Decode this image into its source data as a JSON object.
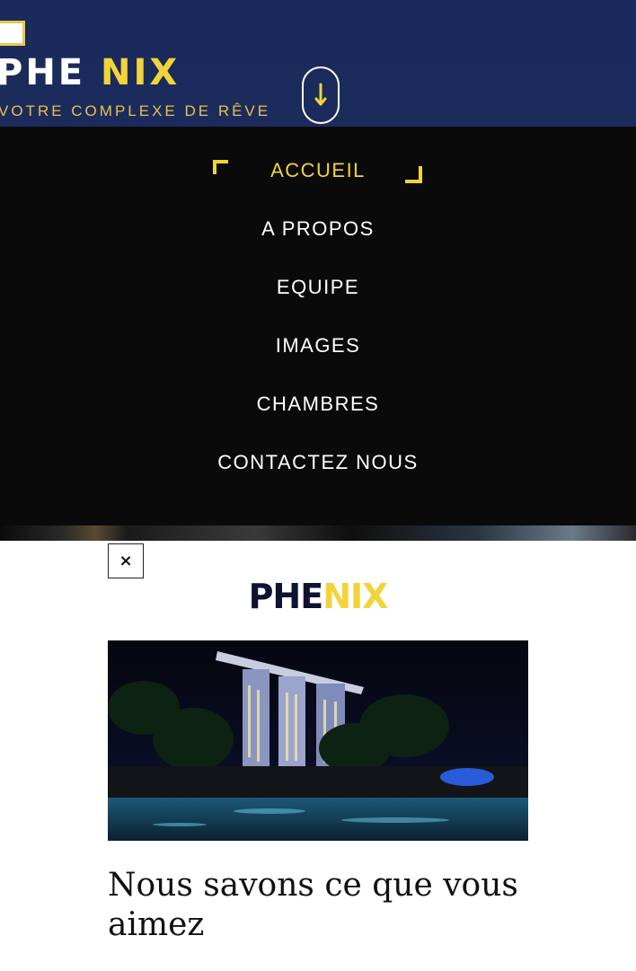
{
  "header": {
    "brand_part1": "PHE ",
    "brand_part2": "NIX",
    "tagline": "VOTRE COMPLEXE DE RÊVE",
    "menu_toggle_icon": "arrow-down-icon",
    "colors": {
      "background": "#1b2b5c",
      "accent": "#f2d43a",
      "text": "#ffffff"
    }
  },
  "nav": {
    "items": [
      {
        "label": "ACCUEIL",
        "active": true
      },
      {
        "label": "A PROPOS",
        "active": false
      },
      {
        "label": "EQUIPE",
        "active": false
      },
      {
        "label": "IMAGES",
        "active": false
      },
      {
        "label": "CHAMBRES",
        "active": false
      },
      {
        "label": "CONTACTEZ NOUS",
        "active": false
      }
    ],
    "colors": {
      "background": "#0a0a0a",
      "active": "#f2d43a",
      "text": "#ffffff"
    }
  },
  "modal": {
    "close_label": "×",
    "logo_part1": "PHE",
    "logo_part2": "NIX",
    "heading": "Nous savons ce que vous aimez"
  }
}
